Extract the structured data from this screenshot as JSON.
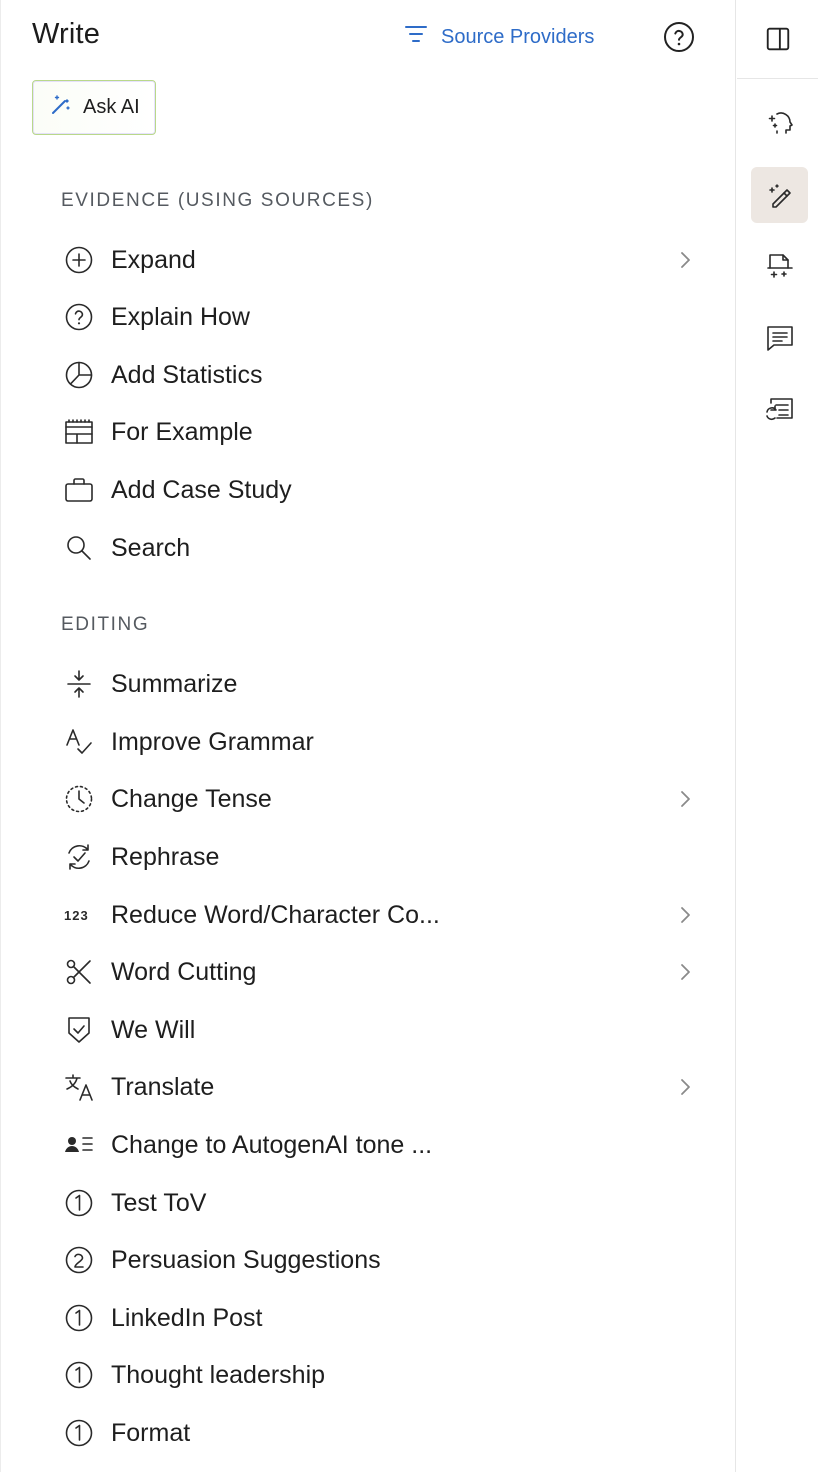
{
  "header": {
    "title": "Write",
    "source_providers_label": "Source Providers",
    "ask_ai_label": "Ask AI"
  },
  "sections": {
    "evidence_title": "EVIDENCE (USING SOURCES)",
    "editing_title": "EDITING"
  },
  "evidence_items": [
    {
      "label": "Expand",
      "icon": "plus-circle-icon",
      "has_submenu": true
    },
    {
      "label": "Explain How",
      "icon": "question-circle-icon",
      "has_submenu": false
    },
    {
      "label": "Add Statistics",
      "icon": "pie-chart-icon",
      "has_submenu": false
    },
    {
      "label": "For Example",
      "icon": "layout-icon",
      "has_submenu": false
    },
    {
      "label": "Add Case Study",
      "icon": "briefcase-icon",
      "has_submenu": false
    },
    {
      "label": "Search",
      "icon": "search-icon",
      "has_submenu": false
    }
  ],
  "editing_items": [
    {
      "label": "Summarize",
      "icon": "compress-icon",
      "has_submenu": false
    },
    {
      "label": "Improve Grammar",
      "icon": "spellcheck-icon",
      "has_submenu": false
    },
    {
      "label": "Change Tense",
      "icon": "clock-icon",
      "has_submenu": true
    },
    {
      "label": "Rephrase",
      "icon": "rephrase-icon",
      "has_submenu": false
    },
    {
      "label": "Reduce Word/Character Co...",
      "icon": "numbers-icon",
      "has_submenu": true
    },
    {
      "label": "Word Cutting",
      "icon": "scissors-icon",
      "has_submenu": true
    },
    {
      "label": "We Will",
      "icon": "shield-check-icon",
      "has_submenu": false
    },
    {
      "label": "Translate",
      "icon": "translate-icon",
      "has_submenu": true
    },
    {
      "label": "Change to AutogenAI tone ...",
      "icon": "user-list-icon",
      "has_submenu": false
    },
    {
      "label": "Test ToV",
      "icon": "number-1-circle-icon",
      "has_submenu": false
    },
    {
      "label": "Persuasion Suggestions",
      "icon": "number-2-circle-icon",
      "has_submenu": false
    },
    {
      "label": "LinkedIn Post",
      "icon": "number-1-circle-icon",
      "has_submenu": false
    },
    {
      "label": "Thought leadership",
      "icon": "number-1-circle-icon",
      "has_submenu": false
    },
    {
      "label": "Format",
      "icon": "number-1-circle-icon",
      "has_submenu": false
    }
  ],
  "rail": {
    "items": [
      {
        "icon": "sidebar-toggle-icon"
      },
      {
        "icon": "ai-head-icon"
      },
      {
        "icon": "magic-pen-icon",
        "active": true
      },
      {
        "icon": "document-sparkle-icon"
      },
      {
        "icon": "comment-icon"
      },
      {
        "icon": "checklist-icon"
      }
    ]
  },
  "colors": {
    "accent": "#2e6cc8",
    "active_rail_bg": "#ede7e2"
  }
}
